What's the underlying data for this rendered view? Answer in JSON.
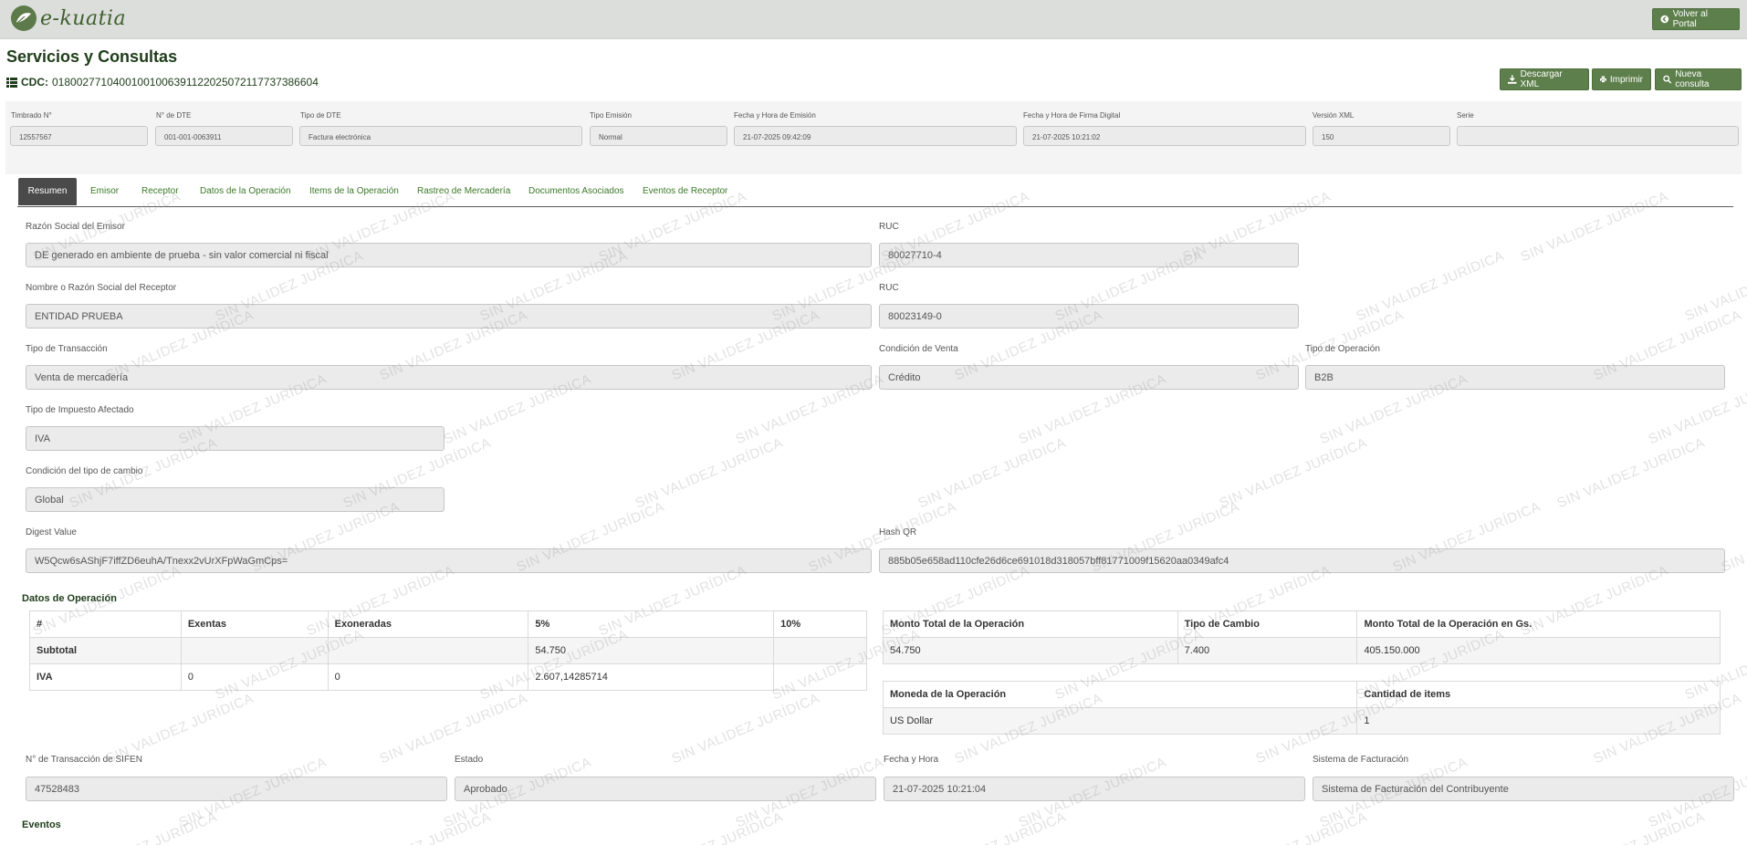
{
  "brand": {
    "logo_text": "e-kuatia"
  },
  "topbar": {
    "portal_label": "Volver al Portal"
  },
  "page": {
    "title": "Servicios y Consultas",
    "cdc_label": "CDC:",
    "cdc_value": "01800277104001001006391122025072117737386604"
  },
  "actions": {
    "download_xml": "Descargar XML",
    "print": "Imprimir",
    "new_query": "Nueva consulta"
  },
  "header_fields": [
    {
      "label": "Timbrado N°",
      "value": "12557567"
    },
    {
      "label": "N° de DTE",
      "value": "001-001-0063911"
    },
    {
      "label": "Tipo de DTE",
      "value": "Factura electrónica"
    },
    {
      "label": "Tipo Emisión",
      "value": "Normal"
    },
    {
      "label": "Fecha y Hora de Emisión",
      "value": "21-07-2025 09:42:09"
    },
    {
      "label": "Fecha y Hora de Firma Digital",
      "value": "21-07-2025 10:21:02"
    },
    {
      "label": "Versión XML",
      "value": "150"
    },
    {
      "label": "Serie",
      "value": ""
    }
  ],
  "tabs": [
    "Resumen",
    "Emisor",
    "Receptor",
    "Datos de la Operación",
    "Items de la Operación",
    "Rastreo de Mercadería",
    "Documentos Asociados",
    "Eventos de Receptor"
  ],
  "summary": {
    "razon_emisor": {
      "label": "Razón Social del Emisor",
      "value": "DE generado en ambiente de prueba - sin valor comercial ni fiscal"
    },
    "ruc_emisor": {
      "label": "RUC",
      "value": "80027710-4"
    },
    "razon_receptor": {
      "label": "Nombre o Razón Social del Receptor",
      "value": "ENTIDAD PRUEBA"
    },
    "ruc_receptor": {
      "label": "RUC",
      "value": "80023149-0"
    },
    "tipo_transaccion": {
      "label": "Tipo de Transacción",
      "value": "Venta de mercadería"
    },
    "condicion_venta": {
      "label": "Condición de Venta",
      "value": "Crédito"
    },
    "tipo_operacion": {
      "label": "Tipo de Operación",
      "value": "B2B"
    },
    "tipo_impuesto": {
      "label": "Tipo de Impuesto Afectado",
      "value": "IVA"
    },
    "condicion_cambio": {
      "label": "Condición del tipo de cambio",
      "value": "Global"
    },
    "digest": {
      "label": "Digest Value",
      "value": "W5Qcw6sAShjF7iffZD6euhA/Tnexx2vUrXFpWaGmCps="
    },
    "hash_qr": {
      "label": "Hash QR",
      "value": "885b05e658ad110cfe26d6ce691018d318057bff81771009f15620aa0349afc4"
    }
  },
  "operacion": {
    "title": "Datos de Operación",
    "tax_table": {
      "headers": [
        "#",
        "Exentas",
        "Exoneradas",
        "5%",
        "10%"
      ],
      "rows": [
        [
          "Subtotal",
          "",
          "",
          "54.750",
          ""
        ],
        [
          "IVA",
          "0",
          "0",
          "2.607,14285714",
          ""
        ]
      ]
    },
    "totals_table": {
      "headers": [
        "Monto Total de la Operación",
        "Tipo de Cambio",
        "Monto Total de la Operación en Gs."
      ],
      "row": [
        "54.750",
        "7.400",
        "405.150.000"
      ]
    },
    "currency_table": {
      "headers": [
        "Moneda de la Operación",
        "Cantidad de items"
      ],
      "row": [
        "US Dollar",
        "1"
      ]
    }
  },
  "sifen": {
    "transaccion": {
      "label": "N° de Transacción de SIFEN",
      "value": "47528483"
    },
    "estado": {
      "label": "Estado",
      "value": "Aprobado"
    },
    "fecha": {
      "label": "Fecha y Hora",
      "value": "21-07-2025 10:21:04"
    },
    "sistema": {
      "label": "Sistema de Facturación",
      "value": "Sistema de Facturación del Contribuyente"
    }
  },
  "eventos": {
    "title": "Eventos"
  },
  "watermark_text": "SIN VALIDEZ JURÍDICA",
  "colors": {
    "brand_green": "#5d7f4b",
    "title_green": "#1e3d1a",
    "tab_link": "#3b7a28",
    "tab_active": "#4a4a4a"
  }
}
